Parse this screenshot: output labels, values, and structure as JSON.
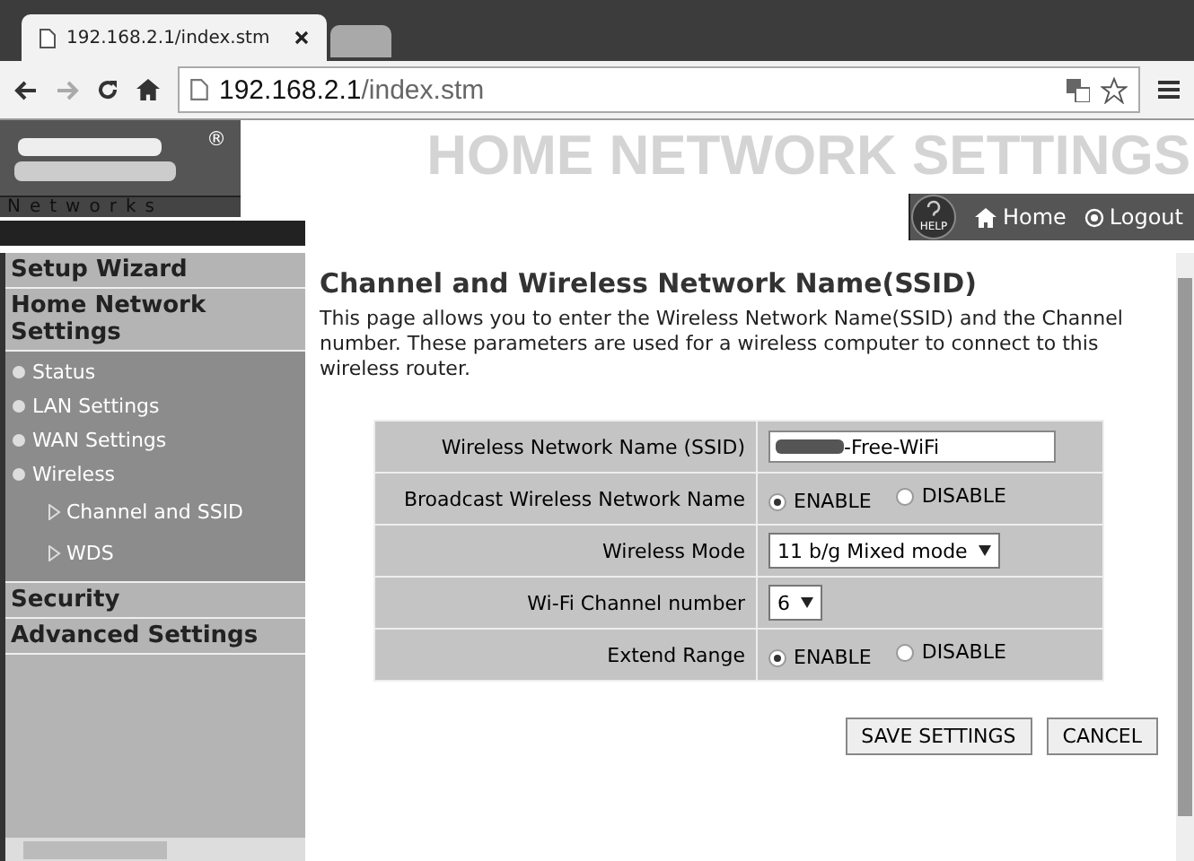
{
  "browser": {
    "tabs": [
      {
        "title": "192.168.2.1/index.stm",
        "selected": true
      },
      {
        "selected": false
      }
    ],
    "address": {
      "host": "192.168.2.1",
      "path": "/index.stm"
    }
  },
  "header": {
    "logo_mark": "®",
    "logo_text": "Networks",
    "banner_title": "HOME NETWORK SETTINGS",
    "help_label": "HELP",
    "nav": [
      {
        "label": "Home",
        "kind": "home"
      },
      {
        "label": "Logout",
        "kind": "logout"
      }
    ]
  },
  "sidebar": {
    "items": [
      {
        "label": "Setup Wizard"
      },
      {
        "label": "Home Network Settings",
        "children": [
          {
            "label": "Status"
          },
          {
            "label": "LAN Settings"
          },
          {
            "label": "WAN Settings"
          },
          {
            "label": "Wireless",
            "children": [
              {
                "label": "Channel and SSID"
              },
              {
                "label": "WDS"
              }
            ]
          }
        ]
      },
      {
        "label": "Security"
      },
      {
        "label": "Advanced Settings"
      }
    ]
  },
  "content": {
    "heading": "Channel and Wireless Network Name(SSID)",
    "description": "This page allows you to enter the Wireless Network Name(SSID) and the Channel number. These parameters are used for a wireless computer to connect to this wireless router.",
    "rows": [
      {
        "label": "Wireless Network Name (SSID)",
        "kind": "text",
        "value": "-Free-WiFi"
      },
      {
        "label": "Broadcast Wireless Network Name",
        "kind": "radio",
        "options": [
          {
            "label": "ENABLE",
            "selected": true
          },
          {
            "label": "DISABLE",
            "selected": false
          }
        ]
      },
      {
        "label": "Wireless Mode",
        "kind": "select",
        "value": "11 b/g Mixed mode"
      },
      {
        "label": "Wi-Fi Channel number",
        "kind": "select",
        "value": "6"
      },
      {
        "label": "Extend Range",
        "kind": "radio",
        "options": [
          {
            "label": "ENABLE",
            "selected": true
          },
          {
            "label": "DISABLE",
            "selected": false
          }
        ]
      }
    ],
    "buttons": [
      "SAVE SETTINGS",
      "CANCEL"
    ]
  }
}
